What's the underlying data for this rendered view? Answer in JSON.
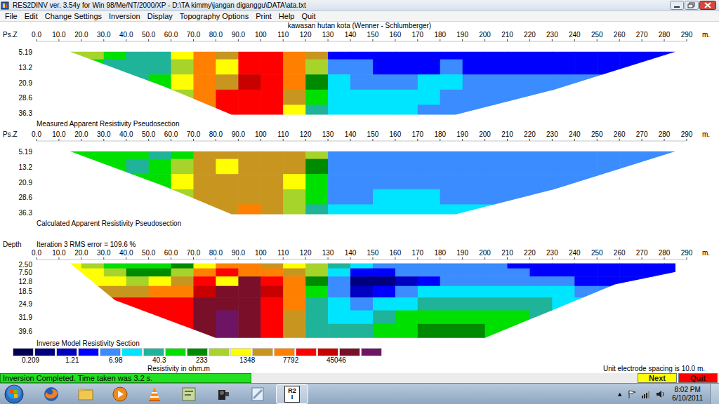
{
  "window": {
    "title": "RES2DINV ver. 3.54y for Win 98/Me/NT/2000/XP - D:\\TA kimmy\\jangan diganggu\\DATA\\ata.txt"
  },
  "menu": [
    "File",
    "Edit",
    "Change Settings",
    "Inversion",
    "Display",
    "Topography Options",
    "Print",
    "Help",
    "Quit"
  ],
  "plot_title": "kawasan hutan kota (Wenner - Schlumberger)",
  "sections": [
    {
      "axis_label": "Ps.Z",
      "x_ticks": [
        "0.0",
        "10.0",
        "20.0",
        "30.0",
        "40.0",
        "50.0",
        "60.0",
        "70.0",
        "80.0",
        "90.0",
        "100",
        "110",
        "120",
        "130",
        "140",
        "150",
        "160",
        "170",
        "180",
        "190",
        "200",
        "210",
        "220",
        "230",
        "240",
        "250",
        "260",
        "270",
        "280",
        "290"
      ],
      "unit": "m.",
      "y_ticks": [
        "5.19",
        "13.2",
        "20.9",
        "28.6",
        "36.3"
      ],
      "caption": "Measured Apparent Resistivity Pseudosection",
      "rows": [
        [
          9,
          9,
          7,
          6,
          6,
          10,
          12,
          11,
          13,
          13,
          12,
          11,
          3,
          3,
          3,
          3,
          3,
          3,
          3,
          3,
          3,
          3,
          3,
          3,
          3,
          3,
          3,
          3
        ],
        [
          7,
          7,
          6,
          6,
          6,
          9,
          12,
          10,
          13,
          13,
          12,
          9,
          4,
          4,
          3,
          3,
          3,
          4,
          3,
          3,
          3,
          3,
          3,
          3,
          3,
          3,
          3,
          3
        ],
        [
          6,
          6,
          6,
          6,
          7,
          10,
          12,
          11,
          14,
          13,
          12,
          8,
          5,
          4,
          4,
          4,
          5,
          5,
          4,
          4,
          4,
          4,
          4,
          4,
          4,
          4,
          4,
          4
        ],
        [
          6,
          6,
          6,
          6,
          7,
          9,
          12,
          13,
          13,
          13,
          11,
          7,
          5,
          5,
          5,
          5,
          5,
          4,
          4,
          4,
          4,
          4,
          4,
          4,
          4,
          4,
          4,
          4
        ],
        [
          6,
          6,
          6,
          6,
          7,
          9,
          11,
          13,
          13,
          13,
          10,
          6,
          5,
          5,
          5,
          5,
          4,
          4,
          4,
          4,
          4,
          4,
          4,
          4,
          4,
          4,
          4,
          4
        ]
      ]
    },
    {
      "axis_label": "Ps.Z",
      "x_ticks": [
        "0.0",
        "10.0",
        "20.0",
        "30.0",
        "40.0",
        "50.0",
        "60.0",
        "70.0",
        "80.0",
        "90.0",
        "100",
        "110",
        "120",
        "130",
        "140",
        "150",
        "160",
        "170",
        "180",
        "190",
        "200",
        "210",
        "220",
        "230",
        "240",
        "250",
        "260",
        "270",
        "280",
        "290"
      ],
      "unit": "m.",
      "y_ticks": [
        "5.19",
        "13.2",
        "20.9",
        "28.6",
        "36.3"
      ],
      "caption": "Calculated Apparent Resistivity Pseudosection",
      "rows": [
        [
          7,
          7,
          7,
          7,
          6,
          7,
          11,
          11,
          11,
          11,
          11,
          9,
          4,
          4,
          4,
          4,
          4,
          4,
          4,
          4,
          4,
          4,
          4,
          4,
          4,
          4,
          4,
          4
        ],
        [
          7,
          7,
          7,
          6,
          7,
          9,
          11,
          10,
          11,
          11,
          11,
          8,
          4,
          4,
          4,
          4,
          4,
          4,
          4,
          4,
          4,
          4,
          4,
          4,
          4,
          4,
          4,
          4
        ],
        [
          6,
          6,
          7,
          7,
          7,
          10,
          11,
          11,
          11,
          11,
          10,
          7,
          4,
          4,
          4,
          4,
          4,
          4,
          4,
          4,
          4,
          4,
          4,
          4,
          4,
          4,
          4,
          4
        ],
        [
          6,
          6,
          6,
          7,
          7,
          9,
          11,
          11,
          11,
          11,
          9,
          7,
          4,
          4,
          5,
          5,
          5,
          4,
          4,
          4,
          4,
          4,
          4,
          4,
          4,
          4,
          4,
          4
        ],
        [
          6,
          6,
          6,
          6,
          7,
          9,
          11,
          11,
          12,
          11,
          9,
          6,
          5,
          5,
          5,
          5,
          5,
          5,
          5,
          5,
          5,
          5,
          4,
          4,
          4,
          4,
          4,
          4
        ]
      ]
    },
    {
      "axis_label": "Depth",
      "header": "Iteration 3 RMS error = 109.6 %",
      "x_ticks": [
        "0.0",
        "10.0",
        "20.0",
        "30.0",
        "40.0",
        "50.0",
        "60.0",
        "70.0",
        "80.0",
        "90.0",
        "100",
        "110",
        "120",
        "130",
        "140",
        "150",
        "160",
        "170",
        "180",
        "190",
        "200",
        "210",
        "220",
        "230",
        "240",
        "250",
        "260",
        "270",
        "280",
        "290"
      ],
      "unit": "m.",
      "y_ticks": [
        "2.50",
        "7.50",
        "12.8",
        "18.5",
        "24.9",
        "31.9",
        "39.6"
      ],
      "caption": "Inverse Model Resistivity Section",
      "rows": [
        [
          10,
          9,
          7,
          7,
          7,
          8,
          10,
          12,
          12,
          11,
          10,
          9,
          6,
          5,
          4,
          4,
          4,
          4,
          4,
          4,
          3,
          3,
          3,
          3,
          3,
          3,
          3,
          3
        ],
        [
          10,
          10,
          9,
          8,
          8,
          9,
          12,
          13,
          12,
          12,
          11,
          9,
          5,
          3,
          3,
          4,
          4,
          4,
          4,
          4,
          4,
          3,
          3,
          3,
          3,
          3,
          3,
          3
        ],
        [
          11,
          10,
          10,
          9,
          10,
          11,
          13,
          10,
          15,
          13,
          12,
          8,
          4,
          1,
          1,
          2,
          3,
          4,
          4,
          4,
          4,
          4,
          4,
          3,
          3,
          3,
          3,
          3
        ],
        [
          12,
          11,
          11,
          11,
          12,
          12,
          14,
          15,
          15,
          14,
          12,
          7,
          4,
          2,
          3,
          4,
          5,
          5,
          5,
          5,
          5,
          5,
          5,
          4,
          4,
          4,
          4,
          4
        ],
        [
          12,
          12,
          13,
          13,
          13,
          13,
          15,
          15,
          15,
          13,
          12,
          6,
          5,
          4,
          5,
          5,
          6,
          6,
          6,
          6,
          6,
          6,
          5,
          5,
          5,
          4,
          4,
          4
        ],
        [
          13,
          13,
          13,
          13,
          13,
          13,
          15,
          16,
          15,
          13,
          11,
          6,
          5,
          5,
          6,
          7,
          7,
          7,
          7,
          7,
          7,
          6,
          6,
          5,
          5,
          5,
          5,
          5
        ],
        [
          13,
          13,
          13,
          13,
          13,
          13,
          15,
          16,
          15,
          13,
          11,
          6,
          6,
          6,
          7,
          7,
          8,
          8,
          8,
          7,
          7,
          7,
          6,
          6,
          5,
          5,
          5,
          5
        ]
      ]
    }
  ],
  "legend": {
    "colors": [
      "#000050",
      "#00007f",
      "#0000c0",
      "#0000ff",
      "#3a8cff",
      "#00e5ff",
      "#1fb39a",
      "#00e000",
      "#008a00",
      "#a6d42a",
      "#ffff00",
      "#c8961e",
      "#ff8000",
      "#ff0000",
      "#c80000",
      "#7a0f2a",
      "#6e1464"
    ],
    "labels": [
      "0.209",
      "1.21",
      "6.98",
      "40.3",
      "233",
      "1348",
      "7792",
      "45046"
    ],
    "title": "Resistivity in ohm.m"
  },
  "electrode_spacing": "Unit electrode spacing is 10.0 m.",
  "status": {
    "message": "Inversion Completed. Time taken was 3.2 s.",
    "buttons": [
      {
        "label": "Next",
        "color": "#ffff00"
      },
      {
        "label": "Quit",
        "color": "#ff0000"
      }
    ]
  },
  "taskbar": {
    "app_badge": [
      "R2",
      "I"
    ],
    "app_badge_active": true,
    "tray_arrow": "▲",
    "time": "8:02 PM",
    "date": "6/10/2011"
  }
}
